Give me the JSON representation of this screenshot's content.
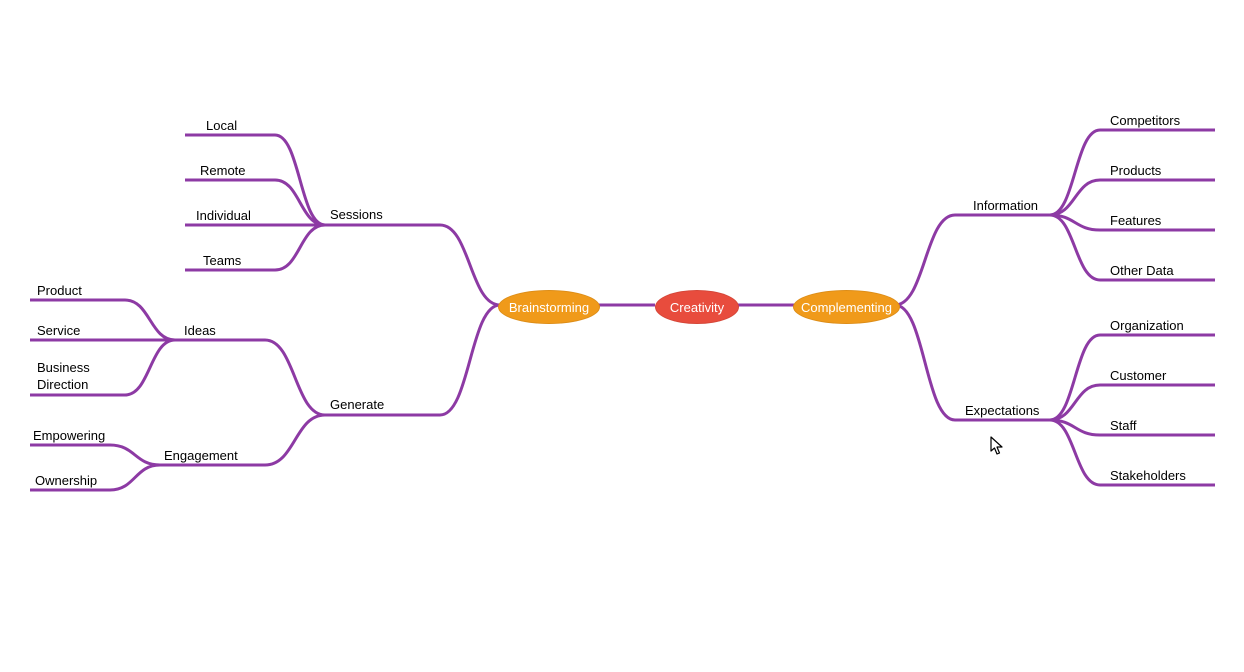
{
  "colors": {
    "line": "#8d3aa4",
    "orange": "#f09a1a",
    "red": "#e84c3d"
  },
  "center": {
    "creativity": "Creativity",
    "brainstorming": "Brainstorming",
    "complementing": "Complementing"
  },
  "left": {
    "sessions": "Sessions",
    "sessions_children": [
      "Local",
      "Remote",
      "Individual",
      "Teams"
    ],
    "generate": "Generate",
    "ideas": "Ideas",
    "ideas_children": [
      "Product",
      "Service",
      "Business\nDirection"
    ],
    "engagement": "Engagement",
    "engagement_children": [
      "Empowering",
      "Ownership"
    ]
  },
  "right": {
    "information": "Information",
    "information_children": [
      "Competitors",
      "Products",
      "Features",
      "Other Data"
    ],
    "expectations": "Expectations",
    "expectations_children": [
      "Organization",
      "Customer",
      "Staff",
      "Stakeholders"
    ]
  }
}
